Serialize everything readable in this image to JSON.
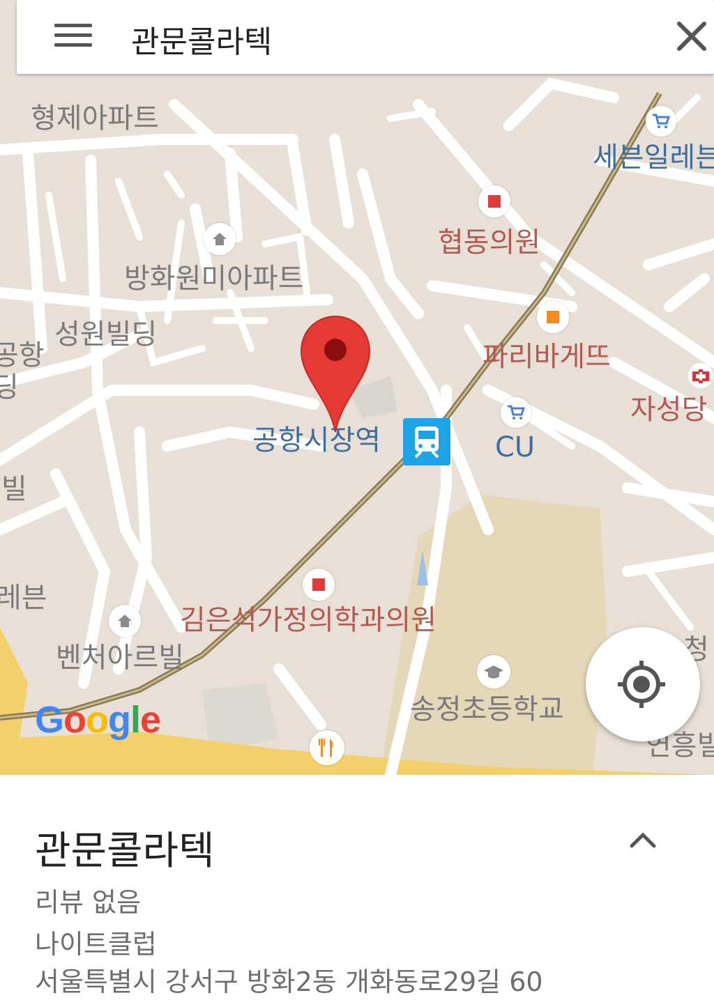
{
  "search": {
    "query": "관문콜라텍"
  },
  "map": {
    "labels": {
      "hyeongje": "형제아파트",
      "seven_top": "세븐일레븐",
      "hyeopdong": "협동의원",
      "banghwa_apt": "방화원미아파트",
      "seongwon": "성원빌딩",
      "gonghang_side": "공항",
      "gonghang_side2": "딩",
      "paris": "파리바게뜨",
      "station": "공항시장역",
      "cu": "CU",
      "jaseongdang": "자성당",
      "bil_left": "빌",
      "seven_left": "레븐",
      "kim_clinic": "김은석가정의학과의원",
      "venture": "벤처아르빌",
      "songjeong": "송정초등학교",
      "yeonheung": "연흥빌",
      "cheong_right": "청"
    },
    "google_logo": "Google"
  },
  "colors": {
    "map_bg": "#e8e0d6",
    "road": "#ffffff",
    "rail": "#8a7a55",
    "major_road": "#f5d36a",
    "school_area": "#e2d4b0",
    "pin": "#e53935",
    "metro_blue": "#1ea3e6"
  },
  "place": {
    "name": "관문콜라텍",
    "reviews": "리뷰 없음",
    "category": "나이트클럽",
    "address": "서울특별시 강서구 방화2동 개화동로29길 60"
  }
}
